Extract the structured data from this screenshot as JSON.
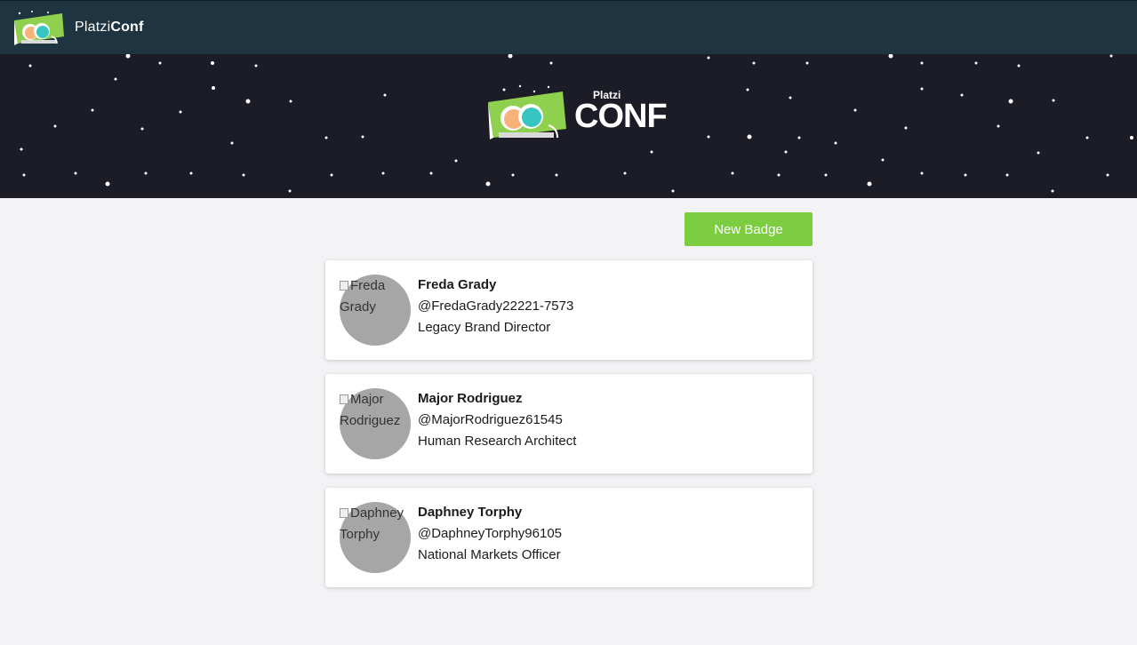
{
  "navbar": {
    "brand_light": "Platzi",
    "brand_bold": "Conf",
    "logo_icon": "platziconf-logo-icon",
    "background": "#1e3440"
  },
  "hero": {
    "platzi_label": "Platzi",
    "conf_label": "CONF",
    "background": "#1b1c25"
  },
  "actions": {
    "new_badge_label": "New Badge",
    "accent": "#7dcd40"
  },
  "badges": [
    {
      "avatar_alt_line1": "Freda",
      "avatar_alt_line2": "Grady",
      "name": "Freda Grady",
      "handle": "@FredaGrady22221-7573",
      "job_title": "Legacy Brand Director"
    },
    {
      "avatar_alt_line1": "Major",
      "avatar_alt_line2": "Rodriguez",
      "name": "Major Rodriguez",
      "handle": "@MajorRodriguez61545",
      "job_title": "Human Research Architect"
    },
    {
      "avatar_alt_line1": "Daphney",
      "avatar_alt_line2": "Torphy",
      "name": "Daphney Torphy",
      "handle": "@DaphneyTorphy96105",
      "job_title": "National Markets Officer"
    }
  ]
}
